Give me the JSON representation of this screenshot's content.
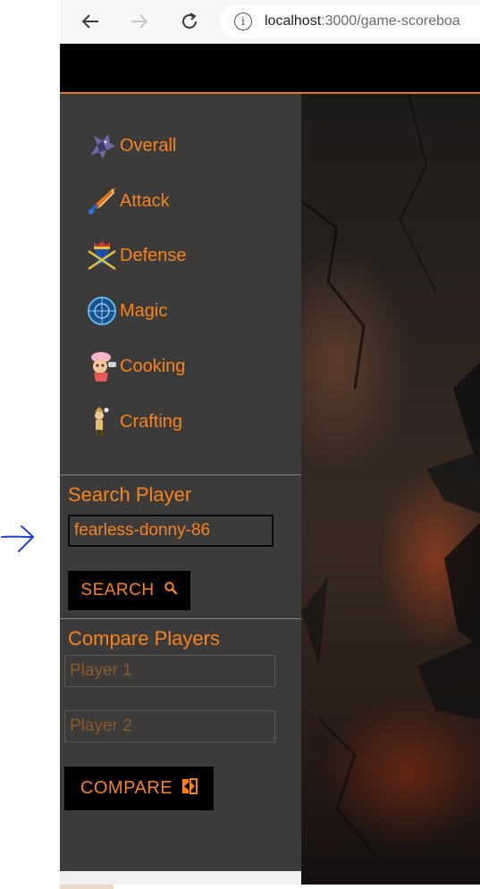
{
  "browser": {
    "back_icon": "arrow-left-icon",
    "forward_icon": "arrow-right-icon",
    "reload_icon": "reload-icon",
    "info_icon": "info-icon",
    "url_host": "localhost",
    "url_path": ":3000/game-scoreboa"
  },
  "sidebar": {
    "nav": [
      {
        "label": "Overall",
        "icon": "dragon-icon"
      },
      {
        "label": "Attack",
        "icon": "sword-icon"
      },
      {
        "label": "Defense",
        "icon": "crest-icon"
      },
      {
        "label": "Magic",
        "icon": "magic-orb-icon"
      },
      {
        "label": "Cooking",
        "icon": "chef-icon"
      },
      {
        "label": "Crafting",
        "icon": "crafter-icon"
      }
    ],
    "search": {
      "title": "Search Player",
      "value": "fearless-donny-86",
      "button_label": "SEARCH",
      "button_icon": "search-icon"
    },
    "compare": {
      "title": "Compare Players",
      "player1_placeholder": "Player 1",
      "player2_placeholder": "Player 2",
      "button_label": "COMPARE",
      "button_icon": "compare-icon"
    }
  },
  "colors": {
    "accent": "#f5841f",
    "sidebar_bg": "#3d3b39",
    "topbar_bg": "#000000"
  }
}
